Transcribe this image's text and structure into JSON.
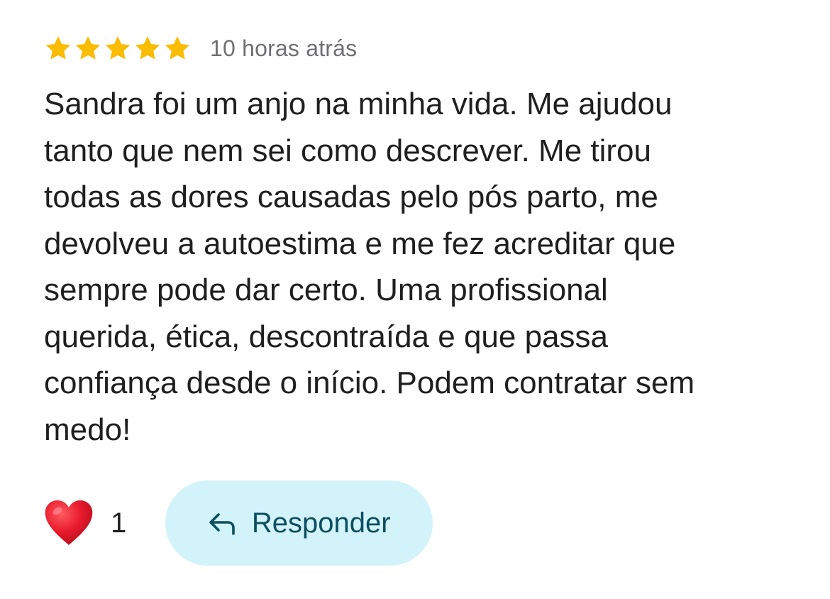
{
  "review": {
    "rating": 5,
    "max_rating": 5,
    "timestamp": "10 horas atrás",
    "text": "Sandra foi um anjo na minha vida. Me ajudou\ntanto que nem sei como descrever. Me tirou\ntodas as dores causadas pelo pós parto, me\ndevolveu a autoestima e me fez acreditar que\nsempre pode dar certo. Uma profissional\nquerida, ética, descontraída e que passa\nconfiança desde o início. Podem contratar sem\nmedo!"
  },
  "actions": {
    "like_icon": "heart-icon",
    "like_count": "1",
    "reply_icon": "reply-arrow-icon",
    "reply_label": "Responder"
  },
  "colors": {
    "star": "#FBBC04",
    "heart": "#E8192C",
    "reply_background": "#D3F3FA",
    "reply_text": "#0C4F61",
    "timestamp": "#6F6F73",
    "body_text": "#1F1F1F"
  }
}
